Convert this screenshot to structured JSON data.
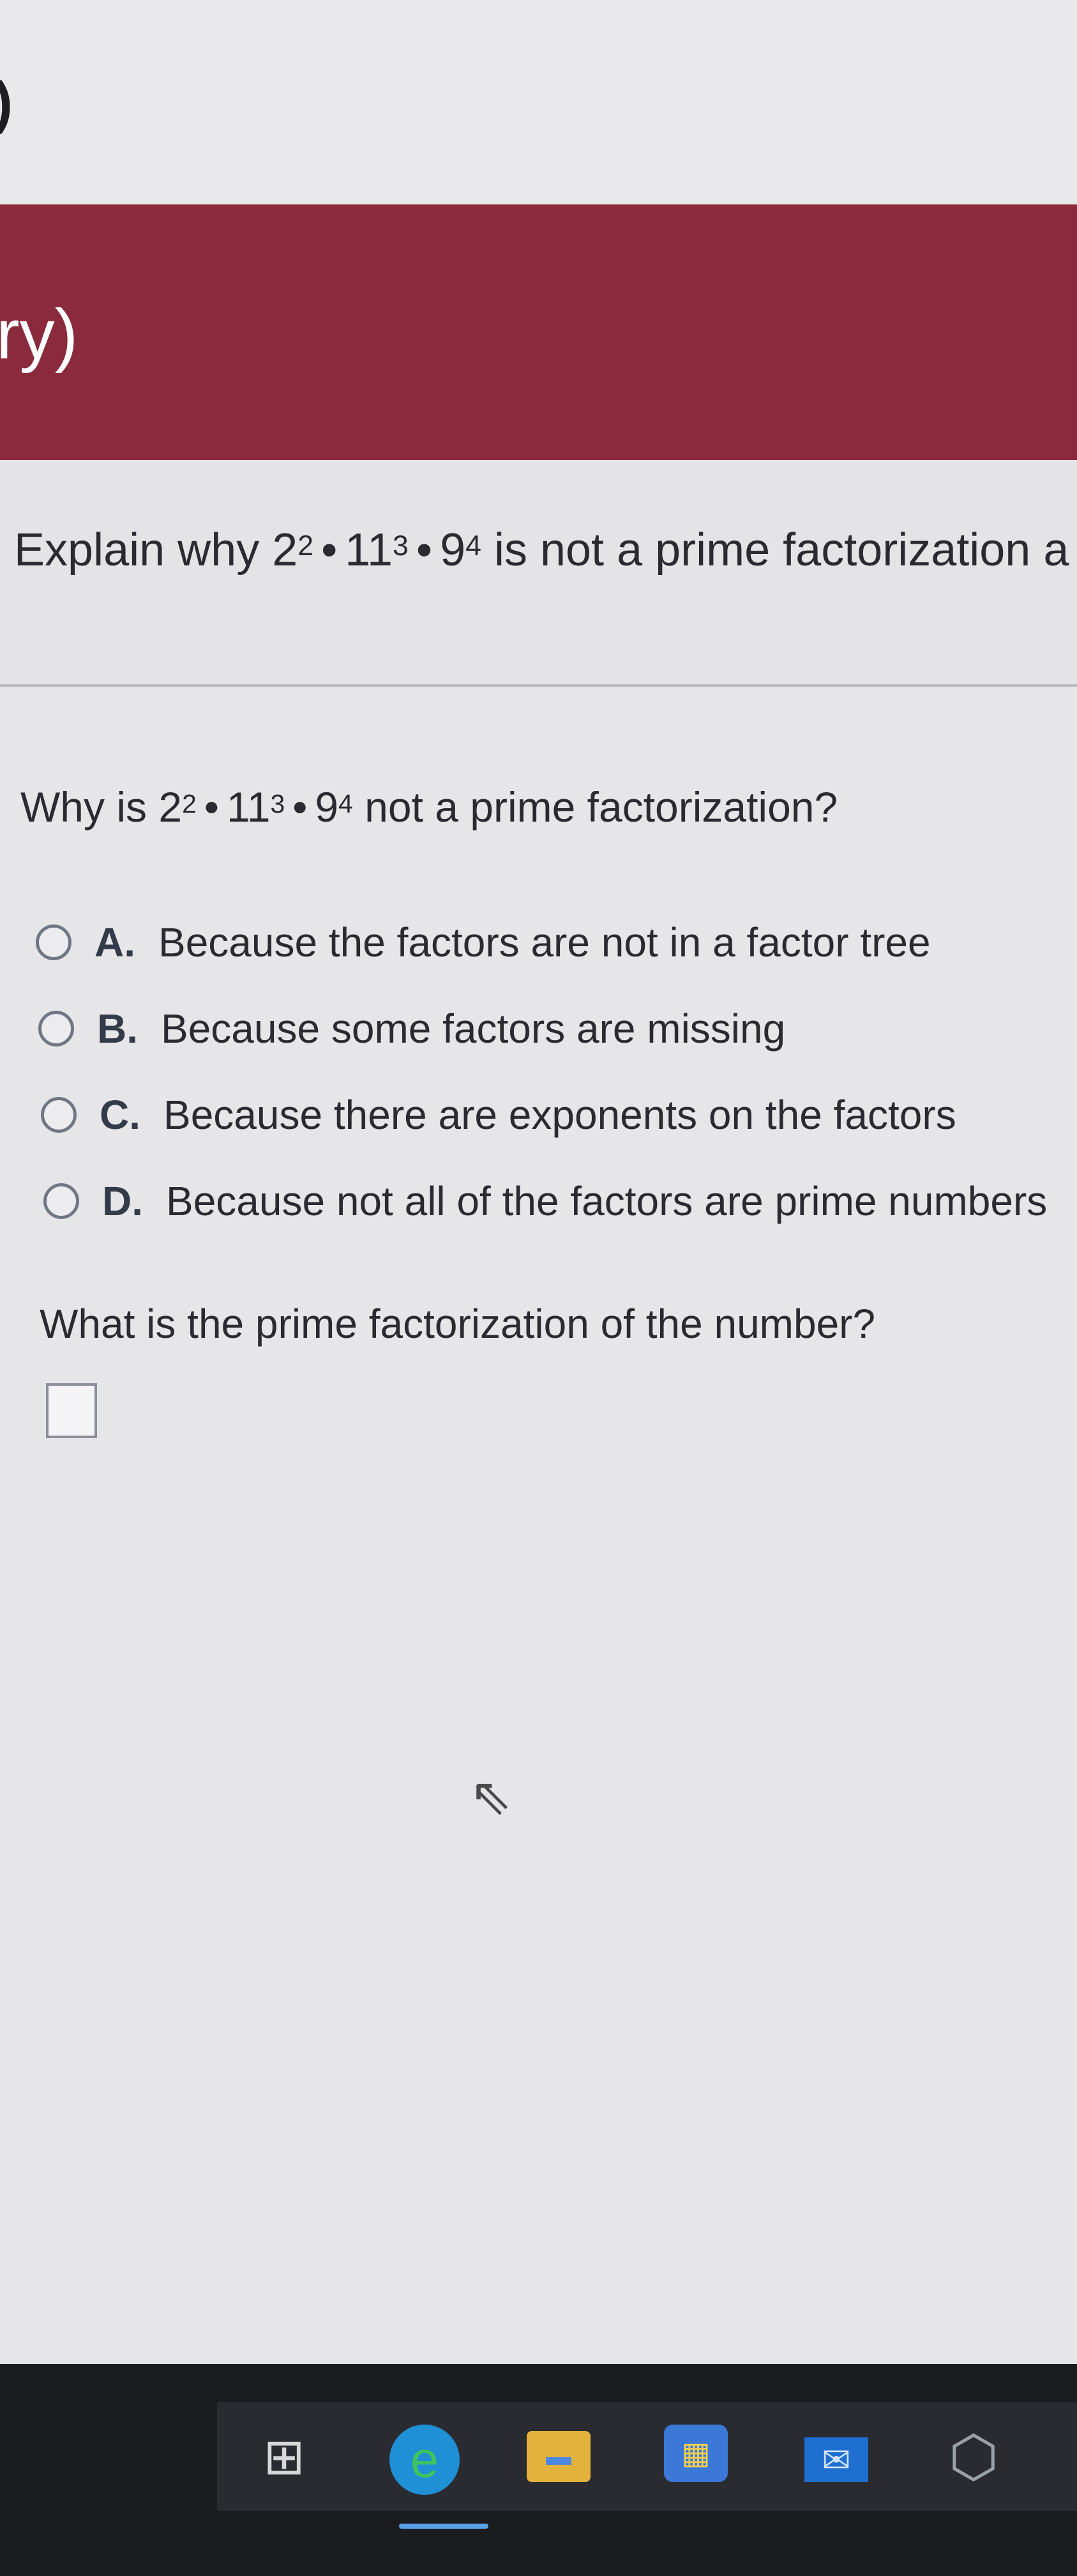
{
  "header": {
    "title_fragment": "ry)",
    "edge_glyph": ")"
  },
  "instruction": {
    "prefix": "Explain why ",
    "expr": {
      "b1": "2",
      "e1": "2",
      "b2": "11",
      "e2": "3",
      "b3": "9",
      "e3": "4",
      "sep": "•"
    },
    "suffix": " is not a prime factorization a"
  },
  "question": {
    "prefix": "Why is ",
    "suffix": " not a prime factorization?"
  },
  "options": [
    {
      "letter": "A.",
      "text": "Because the factors are not in a factor tree"
    },
    {
      "letter": "B.",
      "text": "Because some factors are missing"
    },
    {
      "letter": "C.",
      "text": "Because there are exponents on the factors"
    },
    {
      "letter": "D.",
      "text": "Because not all of the factors are prime numbers"
    }
  ],
  "prompt2": "What is the prime factorization of the number?",
  "taskbar": {
    "icons": [
      "task-view-icon",
      "edge-browser-icon",
      "file-explorer-icon",
      "store-icon",
      "mail-icon",
      "3d-viewer-icon"
    ],
    "glyphs": {
      "taskview": "⊞",
      "edge": "e",
      "explorer": "▬",
      "store": "▦",
      "mail": "✉",
      "app3d": "⬡"
    }
  },
  "colors": {
    "header_band": "#8a2a3c",
    "background": "#e6e6e9"
  }
}
